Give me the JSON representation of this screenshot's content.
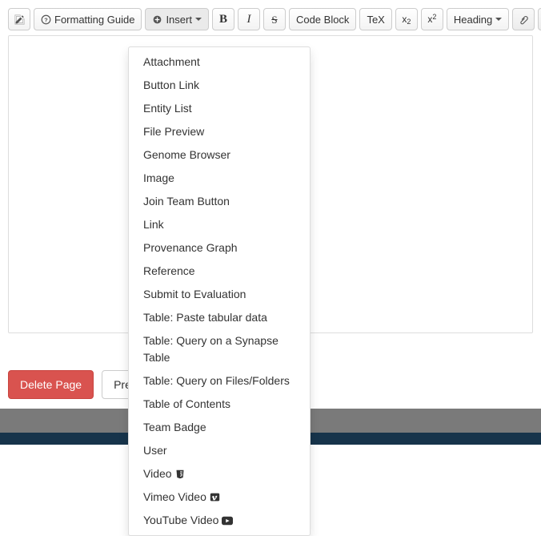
{
  "toolbar": {
    "formatting_guide": "Formatting Guide",
    "insert": "Insert",
    "bold": "B",
    "italic": "I",
    "strike": "S",
    "code_block": "Code Block",
    "tex": "TeX",
    "sub_base": "x",
    "sub_s": "2",
    "sup_base": "x",
    "sup_s": "2",
    "heading": "Heading"
  },
  "insert_menu": [
    {
      "label": "Attachment",
      "name": "insert-attachment"
    },
    {
      "label": "Button Link",
      "name": "insert-button-link"
    },
    {
      "label": "Entity List",
      "name": "insert-entity-list"
    },
    {
      "label": "File Preview",
      "name": "insert-file-preview"
    },
    {
      "label": "Genome Browser",
      "name": "insert-genome-browser"
    },
    {
      "label": "Image",
      "name": "insert-image"
    },
    {
      "label": "Join Team Button",
      "name": "insert-join-team-button"
    },
    {
      "label": "Link",
      "name": "insert-link"
    },
    {
      "label": "Provenance Graph",
      "name": "insert-provenance-graph"
    },
    {
      "label": "Reference",
      "name": "insert-reference"
    },
    {
      "label": "Submit to Evaluation",
      "name": "insert-submit-to-evaluation"
    },
    {
      "label": "Table: Paste tabular data",
      "name": "insert-table-paste"
    },
    {
      "label": "Table: Query on a Synapse Table",
      "name": "insert-table-query-synapse"
    },
    {
      "label": "Table: Query on Files/Folders",
      "name": "insert-table-query-files"
    },
    {
      "label": "Table of Contents",
      "name": "insert-table-of-contents"
    },
    {
      "label": "Team Badge",
      "name": "insert-team-badge"
    },
    {
      "label": "User",
      "name": "insert-user"
    },
    {
      "label": "Video",
      "name": "insert-video",
      "icon": "html5"
    },
    {
      "label": "Vimeo Video",
      "name": "insert-vimeo-video",
      "icon": "vimeo"
    },
    {
      "label": "YouTube Video",
      "name": "insert-youtube-video",
      "icon": "youtube"
    }
  ],
  "buttons": {
    "delete": "Delete Page",
    "preview": "Preview"
  },
  "chart_data": null
}
